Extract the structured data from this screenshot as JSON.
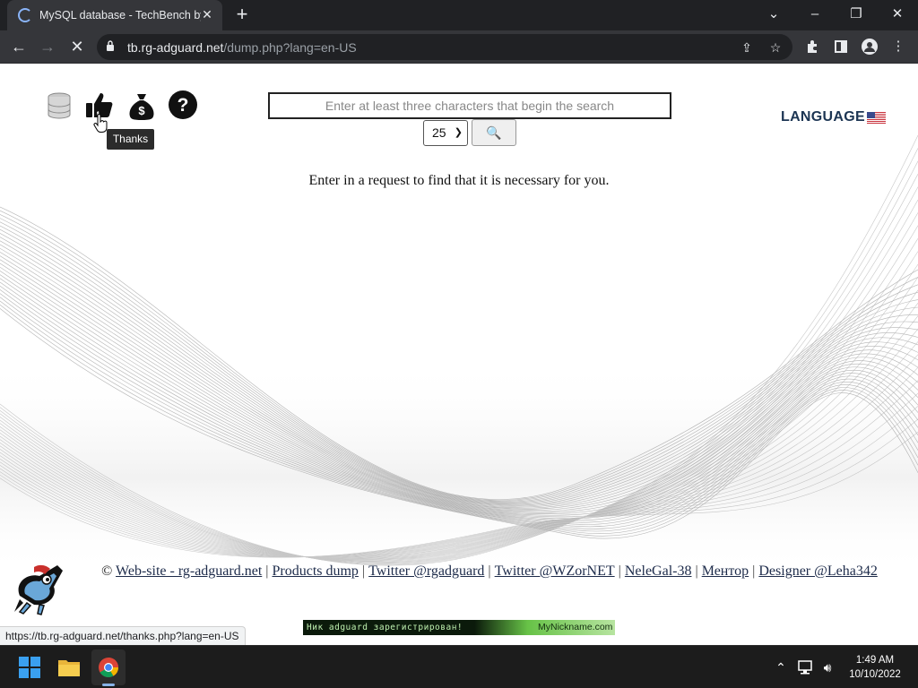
{
  "browser": {
    "tab_title": "MySQL database - TechBench by",
    "url_domain": "tb.rg-adguard.net",
    "url_path": "/dump.php?lang=en-US",
    "status_url": "https://tb.rg-adguard.net/thanks.php?lang=en-US"
  },
  "header": {
    "icons": [
      "database-icon",
      "thumbs-up-icon",
      "money-bag-icon",
      "question-icon"
    ],
    "tooltip": "Thanks"
  },
  "search": {
    "placeholder": "Enter at least three characters that begin the search",
    "page_size": "25",
    "go_icon": "🔍"
  },
  "language": {
    "label": "LANGUAGE"
  },
  "main": {
    "prompt": "Enter in a request to find that it is necessary for you."
  },
  "footer": {
    "copyright": "©",
    "links": [
      "Web-site - rg-adguard.net",
      "Products dump",
      "Twitter @rgadguard",
      "Twitter @WZorNET",
      "NeleGal-38",
      "Ментор",
      "Designer @Leha342"
    ],
    "separator": "|"
  },
  "banner": {
    "left_text": "Ник adguard зарегистрирован!",
    "right_text": "MyNickname.com"
  },
  "taskbar": {
    "time": "1:49 AM",
    "date": "10/10/2022"
  },
  "colors": {
    "chrome_dark": "#202124",
    "chrome_tab": "#35363a",
    "language_text": "#1c3553",
    "link": "#1d2b4a"
  }
}
